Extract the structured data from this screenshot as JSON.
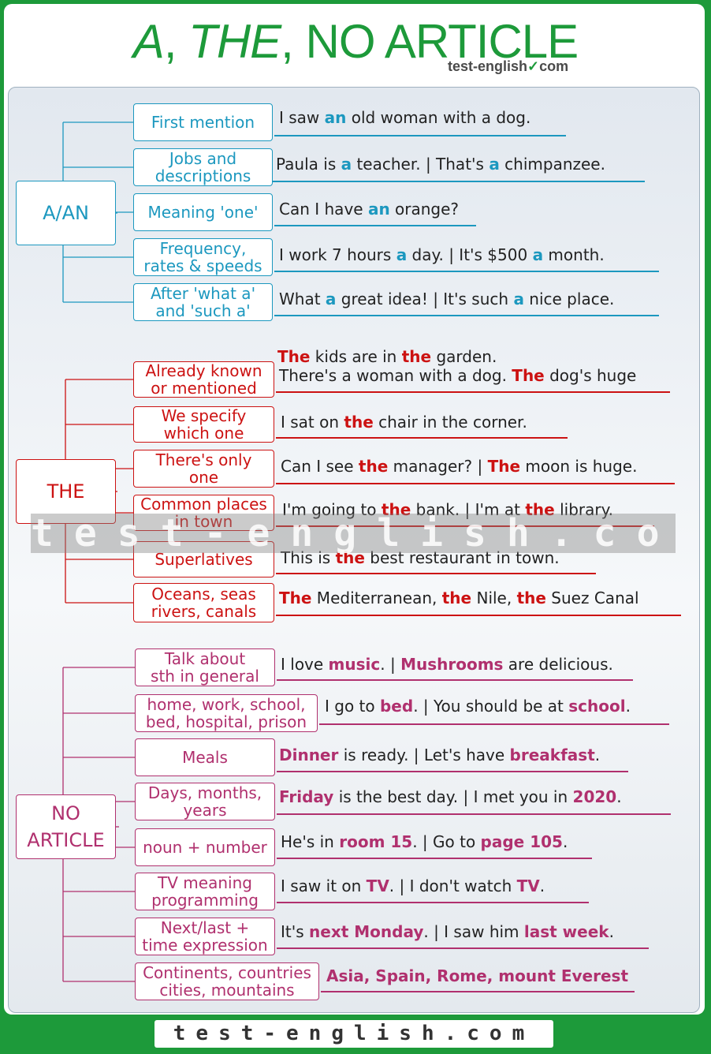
{
  "title": {
    "p1": "A",
    "p2": ", ",
    "p3": "THE",
    "p4": ", NO ARTICLE"
  },
  "brand": {
    "name": "test-english",
    "check": "✓",
    "dom": "com"
  },
  "watermark": "test-english.com",
  "footer": "test-english.com",
  "colors": {
    "blue": "#1c98bf",
    "red": "#cc1212",
    "pink": "#b0306e",
    "green": "#1d9a3a"
  },
  "groups": [
    {
      "label": "A/AN",
      "color": "blue",
      "rules": [
        {
          "label": "First mention",
          "sentence": [
            [
              "I saw ",
              0
            ],
            [
              "an",
              1
            ],
            [
              " old woman with a dog.",
              0
            ]
          ]
        },
        {
          "label": "Jobs and\ndescriptions",
          "sentence": [
            [
              "Paula is ",
              0
            ],
            [
              "a",
              1
            ],
            [
              " teacher. | That's ",
              0
            ],
            [
              "a",
              1
            ],
            [
              " chimpanzee.",
              0
            ]
          ]
        },
        {
          "label": "Meaning 'one'",
          "sentence": [
            [
              "Can I have ",
              0
            ],
            [
              "an",
              1
            ],
            [
              " orange?",
              0
            ]
          ]
        },
        {
          "label": "Frequency,\nrates & speeds",
          "sentence": [
            [
              "I work 7 hours ",
              0
            ],
            [
              "a",
              1
            ],
            [
              " day. | It's $500 ",
              0
            ],
            [
              "a",
              1
            ],
            [
              " month.",
              0
            ]
          ]
        },
        {
          "label": "After 'what a'\nand 'such a'",
          "sentence": [
            [
              "What ",
              0
            ],
            [
              "a",
              1
            ],
            [
              " great idea! | It's such ",
              0
            ],
            [
              "a",
              1
            ],
            [
              " nice place.",
              0
            ]
          ]
        }
      ]
    },
    {
      "label": "THE",
      "color": "red",
      "rules": [
        {
          "label": "Already known\nor mentioned",
          "sentence_top": [
            [
              "The",
              1
            ],
            [
              " kids are in ",
              0
            ],
            [
              "the",
              1
            ],
            [
              " garden.",
              0
            ]
          ],
          "sentence": [
            [
              "There's a woman with a dog. ",
              0
            ],
            [
              "The",
              1
            ],
            [
              " dog's huge",
              0
            ]
          ]
        },
        {
          "label": "We specify\nwhich one",
          "sentence": [
            [
              "I sat on ",
              0
            ],
            [
              "the",
              1
            ],
            [
              " chair in the corner.",
              0
            ]
          ]
        },
        {
          "label": "There's only\none",
          "sentence": [
            [
              "Can I see ",
              0
            ],
            [
              "the",
              1
            ],
            [
              " manager? | ",
              0
            ],
            [
              "The",
              1
            ],
            [
              " moon is huge.",
              0
            ]
          ]
        },
        {
          "label": "Common places\nin town",
          "sentence": [
            [
              "I'm going to ",
              0
            ],
            [
              "the",
              1
            ],
            [
              " bank. | I'm at ",
              0
            ],
            [
              "the",
              1
            ],
            [
              " library.",
              0
            ]
          ]
        },
        {
          "label": "Superlatives",
          "sentence": [
            [
              "This is ",
              0
            ],
            [
              "the",
              1
            ],
            [
              " best restaurant in town.",
              0
            ]
          ]
        },
        {
          "label": "Oceans, seas\nrivers, canals",
          "sentence": [
            [
              "The",
              1
            ],
            [
              " Mediterranean, ",
              0
            ],
            [
              "the",
              1
            ],
            [
              " Nile, ",
              0
            ],
            [
              "the",
              1
            ],
            [
              " Suez Canal",
              0
            ]
          ]
        }
      ]
    },
    {
      "label": "NO\nARTICLE",
      "color": "pink",
      "rules": [
        {
          "label": "Talk about\nsth in general",
          "sentence": [
            [
              "I love ",
              0
            ],
            [
              "music",
              1
            ],
            [
              ". | ",
              0
            ],
            [
              "Mushrooms",
              1
            ],
            [
              " are delicious.",
              0
            ]
          ]
        },
        {
          "label": "home, work, school,\nbed, hospital, prison",
          "sentence": [
            [
              "I go to ",
              0
            ],
            [
              "bed",
              1
            ],
            [
              ". | You should be at ",
              0
            ],
            [
              "school",
              1
            ],
            [
              ".",
              0
            ]
          ]
        },
        {
          "label": "Meals",
          "sentence": [
            [
              "Dinner",
              1
            ],
            [
              " is ready. | Let's have ",
              0
            ],
            [
              "breakfast",
              1
            ],
            [
              ".",
              0
            ]
          ]
        },
        {
          "label": "Days, months,\nyears",
          "sentence": [
            [
              "Friday",
              1
            ],
            [
              " is the best day. | I met you in ",
              0
            ],
            [
              "2020",
              1
            ],
            [
              ".",
              0
            ]
          ]
        },
        {
          "label": "noun + number",
          "sentence": [
            [
              "He's in ",
              0
            ],
            [
              "room 15",
              1
            ],
            [
              ". | Go to ",
              0
            ],
            [
              "page 105",
              1
            ],
            [
              ".",
              0
            ]
          ]
        },
        {
          "label": "TV meaning\nprogramming",
          "sentence": [
            [
              "I saw it on ",
              0
            ],
            [
              "TV",
              1
            ],
            [
              ". | I don't watch ",
              0
            ],
            [
              "TV",
              1
            ],
            [
              ".",
              0
            ]
          ]
        },
        {
          "label": "Next/last +\ntime expression",
          "sentence": [
            [
              "It's ",
              0
            ],
            [
              "next Monday",
              1
            ],
            [
              ". | I saw him ",
              0
            ],
            [
              "last week",
              1
            ],
            [
              ".",
              0
            ]
          ]
        },
        {
          "label": "Continents, countries\ncities, mountains",
          "sentence": [
            [
              "Asia, Spain, Rome, mount Everest",
              1
            ]
          ]
        }
      ]
    }
  ]
}
